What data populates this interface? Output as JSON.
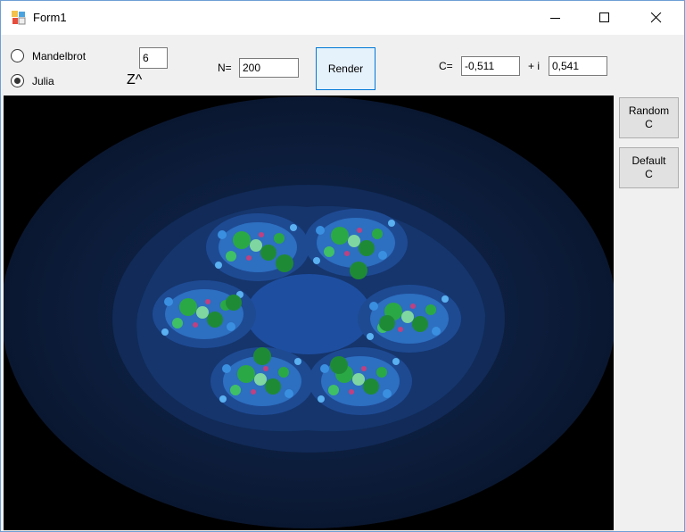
{
  "window": {
    "title": "Form1"
  },
  "controls": {
    "mode_mandelbrot_label": "Mandelbrot",
    "mode_julia_label": "Julia",
    "selected_mode": "Julia",
    "power_value": "6",
    "power_label": "Z^",
    "n_label": "N=",
    "n_value": "200",
    "render_label": "Render",
    "c_label": "C=",
    "c_real_value": "-0,511",
    "i_label": "+ i",
    "c_imag_value": "0,541"
  },
  "side_buttons": {
    "random_line1": "Random",
    "random_line2": "C",
    "default_line1": "Default",
    "default_line2": "C"
  },
  "fractal": {
    "type": "Julia set",
    "background_color": "#000000",
    "colors": [
      "#0b1a33",
      "#132c5c",
      "#1d4a9a",
      "#2f7fd0",
      "#2aa845",
      "#7fd6a0",
      "#c04080"
    ]
  }
}
